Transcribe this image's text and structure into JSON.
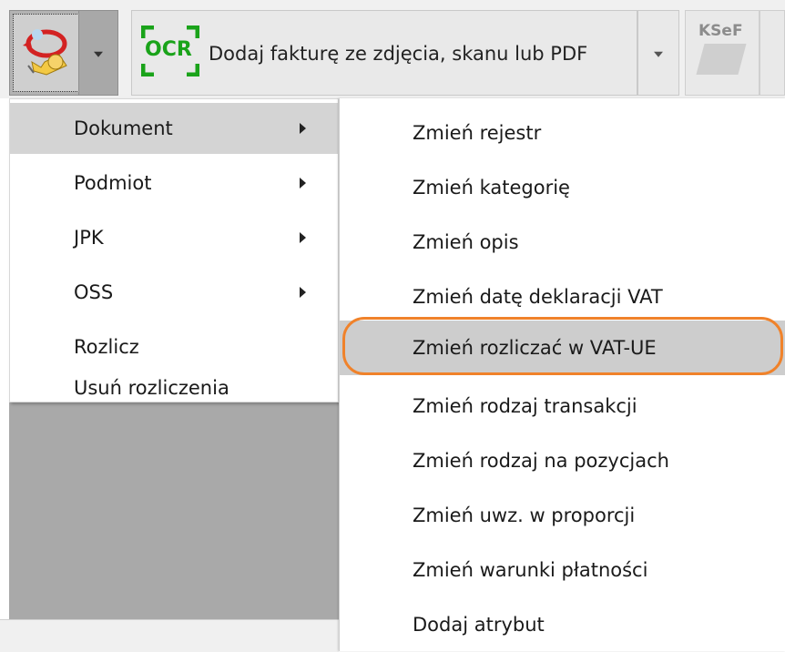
{
  "toolbar": {
    "ocr_icon_label": "OCR",
    "ocr_button_label": "Dodaj fakturę ze zdjęcia, skanu lub PDF",
    "ksef_label": "KSeF"
  },
  "menu_main": {
    "items": [
      {
        "label": "Dokument",
        "has_submenu": true,
        "active": true
      },
      {
        "label": "Podmiot",
        "has_submenu": true
      },
      {
        "label": "JPK",
        "has_submenu": true
      },
      {
        "label": "OSS",
        "has_submenu": true
      },
      {
        "label": "Rozlicz",
        "has_submenu": false
      },
      {
        "label": "Usuń rozliczenia",
        "has_submenu": false
      }
    ]
  },
  "menu_dokument": {
    "items": [
      {
        "label": "Zmień rejestr"
      },
      {
        "label": "Zmień kategorię"
      },
      {
        "label": "Zmień opis"
      },
      {
        "label": "Zmień datę deklaracji VAT"
      },
      {
        "label": "Zmień rozliczać w VAT-UE",
        "highlighted": true
      },
      {
        "label": "Zmień rodzaj transakcji"
      },
      {
        "label": "Zmień rodzaj na pozycjach"
      },
      {
        "label": "Zmień uwz. w proporcji"
      },
      {
        "label": "Zmień warunki płatności"
      },
      {
        "label": "Dodaj atrybut"
      }
    ]
  },
  "colors": {
    "highlight_ring": "#f0822a",
    "ocr_green": "#1aa31a"
  }
}
